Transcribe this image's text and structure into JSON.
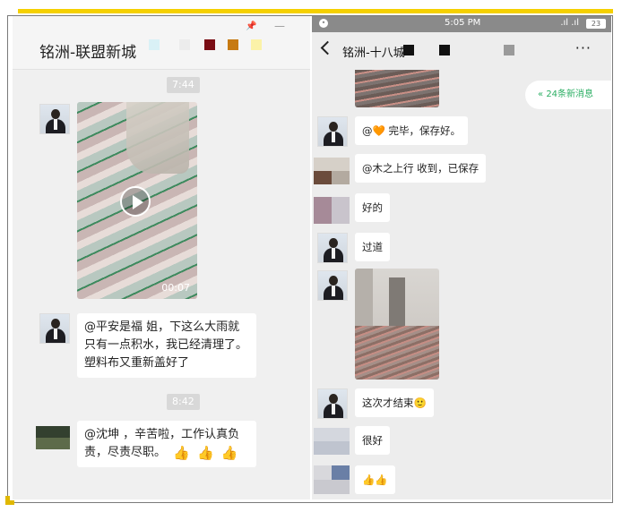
{
  "left": {
    "title": "铭洲-联盟新城",
    "window_icons": [
      "pin-icon",
      "minimize-icon"
    ],
    "time_1": "7:44",
    "video_duration": "00:07",
    "msg_1": "@平安是福 姐，下这么大雨就只有一点积水，我已经清理了。塑料布又重新盖好了",
    "time_2": "8:42",
    "msg_2": "@沈坤 ，辛苦啦，工作认真负责，尽责尽职。",
    "msg_2_emojis": [
      "👍",
      "👍",
      "👍"
    ]
  },
  "right": {
    "status": {
      "time": "5:05 PM",
      "battery": "23"
    },
    "title": "铭洲-十八城",
    "new_messages": "24条新消息",
    "messages": [
      {
        "text": "@🧡 完毕，保存好。"
      },
      {
        "text": "@木之上行 收到，已保存"
      },
      {
        "text": "好的"
      },
      {
        "text": "过道"
      },
      {
        "text": "这次才结束🙂"
      },
      {
        "text": "很好"
      },
      {
        "text": "👍👍"
      }
    ]
  },
  "colors": {
    "accent_yellow": "#f5d000",
    "wechat_green": "#2bae63"
  }
}
